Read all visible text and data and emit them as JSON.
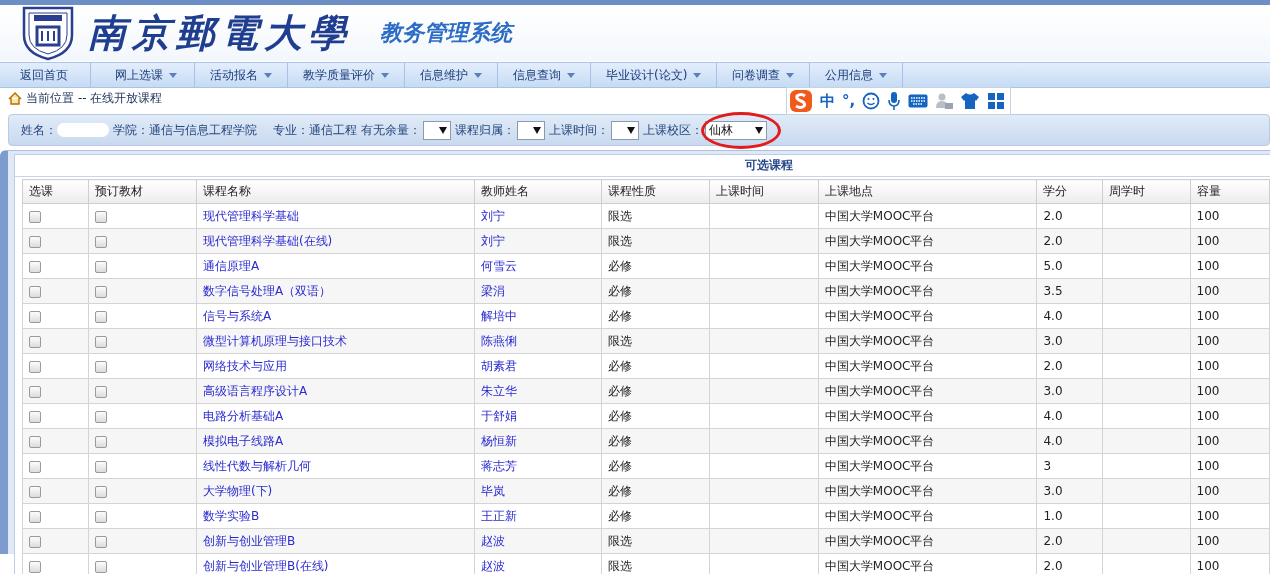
{
  "header": {
    "logo_text": "南京郵電大學",
    "system_title": "教务管理系统"
  },
  "nav": [
    {
      "label": "返回首页",
      "has_menu": false
    },
    {
      "label": "网上选课",
      "has_menu": true
    },
    {
      "label": "活动报名",
      "has_menu": true
    },
    {
      "label": "教学质量评价",
      "has_menu": true
    },
    {
      "label": "信息维护",
      "has_menu": true
    },
    {
      "label": "信息查询",
      "has_menu": true
    },
    {
      "label": "毕业设计(论文)",
      "has_menu": true
    },
    {
      "label": "问卷调查",
      "has_menu": true
    },
    {
      "label": "公用信息",
      "has_menu": true
    }
  ],
  "ime_toolbar": [
    {
      "kind": "logo"
    },
    {
      "kind": "text",
      "label": "中"
    },
    {
      "kind": "text",
      "label": "°,"
    },
    {
      "kind": "smiley"
    },
    {
      "kind": "mic"
    },
    {
      "kind": "keyboard"
    },
    {
      "kind": "person"
    },
    {
      "kind": "shirt"
    },
    {
      "kind": "grid"
    }
  ],
  "breadcrumb": {
    "label": "当前位置",
    "path": "-- 在线开放课程"
  },
  "filters": {
    "name_label": "姓名：",
    "college": "学院：通信与信息工程学院",
    "major": "专业：通信工程",
    "selects": [
      {
        "label": "有无余量：",
        "circled": false
      },
      {
        "label": "课程归属：",
        "circled": false
      },
      {
        "label": "上课时间：",
        "circled": false
      },
      {
        "label": "上课校区：",
        "value": "仙林",
        "circled": true
      }
    ]
  },
  "table": {
    "title": "可选课程",
    "columns": [
      "选课",
      "预订教材",
      "课程名称",
      "教师姓名",
      "课程性质",
      "上课时间",
      "上课地点",
      "学分",
      "周学时",
      "容量"
    ],
    "rows": [
      {
        "select": false,
        "book": false,
        "course": "现代管理科学基础",
        "teacher": "刘宁",
        "type": "限选",
        "place": "中国大学MOOC平台",
        "credit": "2.0",
        "capacity": "100"
      },
      {
        "select": false,
        "book": false,
        "course": "现代管理科学基础(在线)",
        "teacher": "刘宁",
        "type": "限选",
        "place": "中国大学MOOC平台",
        "credit": "2.0",
        "capacity": "100"
      },
      {
        "select": false,
        "book": false,
        "course": "通信原理A",
        "teacher": "何雪云",
        "type": "必修",
        "place": "中国大学MOOC平台",
        "credit": "5.0",
        "capacity": "100"
      },
      {
        "select": false,
        "book": false,
        "course": "数字信号处理A（双语）",
        "teacher": "梁涓",
        "type": "必修",
        "place": "中国大学MOOC平台",
        "credit": "3.5",
        "capacity": "100"
      },
      {
        "select": false,
        "book": false,
        "course": "信号与系统A",
        "teacher": "解培中",
        "type": "必修",
        "place": "中国大学MOOC平台",
        "credit": "4.0",
        "capacity": "100"
      },
      {
        "select": false,
        "book": false,
        "course": "微型计算机原理与接口技术",
        "teacher": "陈燕俐",
        "type": "限选",
        "place": "中国大学MOOC平台",
        "credit": "3.0",
        "capacity": "100"
      },
      {
        "select": false,
        "book": false,
        "course": "网络技术与应用",
        "teacher": "胡素君",
        "type": "必修",
        "place": "中国大学MOOC平台",
        "credit": "2.0",
        "capacity": "100"
      },
      {
        "select": false,
        "book": false,
        "course": "高级语言程序设计A",
        "teacher": "朱立华",
        "type": "必修",
        "place": "中国大学MOOC平台",
        "credit": "3.0",
        "capacity": "100"
      },
      {
        "select": false,
        "book": false,
        "course": "电路分析基础A",
        "teacher": "于舒娟",
        "type": "必修",
        "place": "中国大学MOOC平台",
        "credit": "4.0",
        "capacity": "100"
      },
      {
        "select": false,
        "book": false,
        "course": "模拟电子线路A",
        "teacher": "杨恒新",
        "type": "必修",
        "place": "中国大学MOOC平台",
        "credit": "4.0",
        "capacity": "100"
      },
      {
        "select": false,
        "book": false,
        "course": "线性代数与解析几何",
        "teacher": "蒋志芳",
        "type": "必修",
        "place": "中国大学MOOC平台",
        "credit": "3",
        "capacity": "100"
      },
      {
        "select": false,
        "book": false,
        "course": "大学物理(下)",
        "teacher": "毕岚",
        "type": "必修",
        "place": "中国大学MOOC平台",
        "credit": "3.0",
        "capacity": "100"
      },
      {
        "select": false,
        "book": false,
        "course": "数学实验B",
        "teacher": "王正新",
        "type": "必修",
        "place": "中国大学MOOC平台",
        "credit": "1.0",
        "capacity": "100"
      },
      {
        "select": false,
        "book": false,
        "course": "创新与创业管理B",
        "teacher": "赵波",
        "type": "限选",
        "place": "中国大学MOOC平台",
        "credit": "2.0",
        "capacity": "100"
      },
      {
        "select": false,
        "book": false,
        "course": "创新与创业管理B(在线)",
        "teacher": "赵波",
        "type": "限选",
        "place": "中国大学MOOC平台",
        "credit": "2.0",
        "capacity": "100"
      }
    ]
  }
}
